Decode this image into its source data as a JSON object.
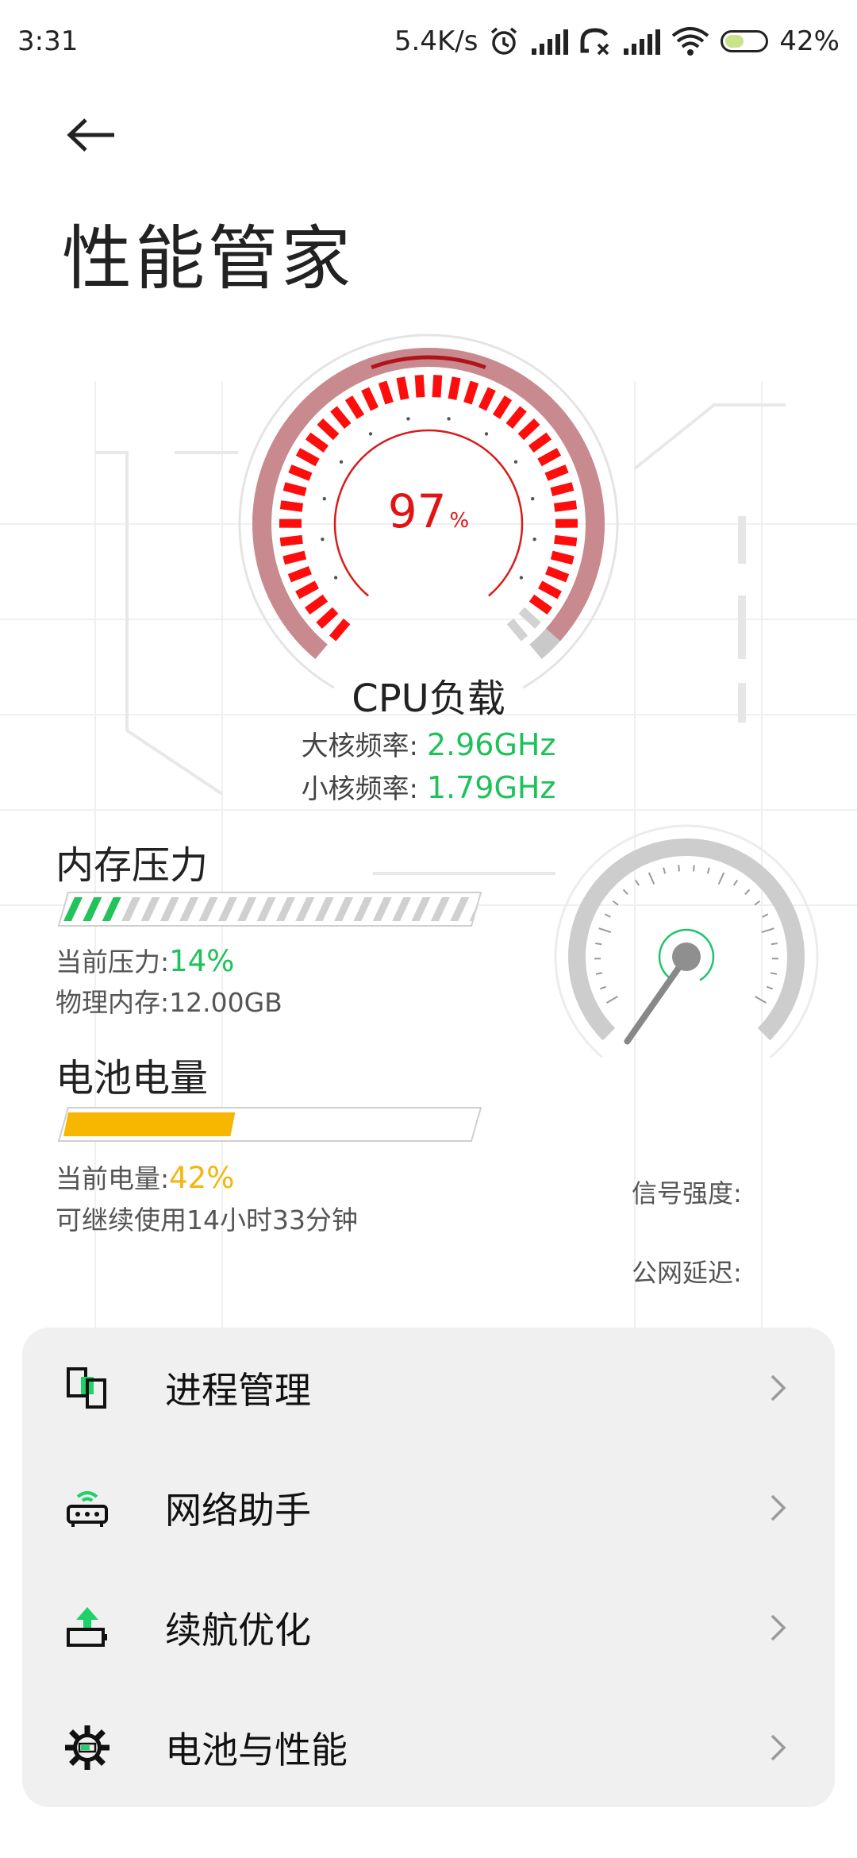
{
  "status_bar": {
    "time": "3:31",
    "net_speed": "5.4K/s",
    "battery_pct": "42%",
    "icons": [
      "alarm-icon",
      "signal-icon",
      "call-off-icon",
      "signal-icon",
      "wifi-icon",
      "battery-icon"
    ]
  },
  "header": {
    "title": "性能管家"
  },
  "cpu": {
    "load_value": "97",
    "load_unit": "%",
    "load_fraction": 0.97,
    "label": "CPU负载",
    "big_core_label": "大核频率:",
    "big_core_value": "2.96GHz",
    "small_core_label": "小核频率:",
    "small_core_value": "1.79GHz"
  },
  "memory": {
    "title": "内存压力",
    "pressure_label": "当前压力:",
    "pressure_value": "14%",
    "pressure_fraction": 0.14,
    "physical_label": "物理内存:",
    "physical_value": "12.00GB"
  },
  "battery": {
    "title": "电池电量",
    "level_label": "当前电量:",
    "level_value": "42%",
    "level_fraction": 0.42,
    "remaining": "可继续使用14小时33分钟"
  },
  "network": {
    "signal_label": "信号强度:",
    "latency_label": "公网延迟:"
  },
  "menu": [
    {
      "label": "进程管理",
      "icon": "process-icon"
    },
    {
      "label": "网络助手",
      "icon": "router-icon"
    },
    {
      "label": "续航优化",
      "icon": "battery-boost-icon"
    },
    {
      "label": "电池与性能",
      "icon": "gear-icon"
    }
  ],
  "colors": {
    "accent_red": "#e21313",
    "accent_green": "#1ec25a",
    "accent_yellow": "#f2b60c",
    "card_bg": "#f0f0f0"
  }
}
